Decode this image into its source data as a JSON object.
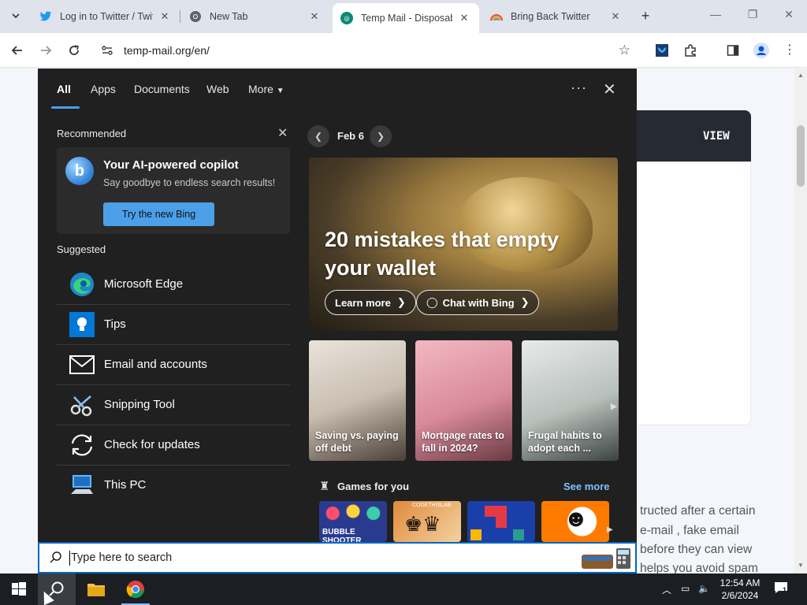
{
  "browser": {
    "tabs": [
      {
        "title": "Log in to Twitter / Twit",
        "icon": "twitter-icon"
      },
      {
        "title": "New Tab",
        "icon": "chrome-icon"
      },
      {
        "title": "Temp Mail - Disposabl",
        "icon": "tempmail-icon",
        "active": true
      },
      {
        "title": "Bring Back Twitter",
        "icon": "rainbow-icon"
      }
    ],
    "url": "temp-mail.org/en/"
  },
  "page": {
    "view_label": "VIEW",
    "text_lines": [
      "tructed after a certain",
      "e-mail , fake email",
      "before they can view",
      "helps you avoid spam"
    ]
  },
  "search_panel": {
    "tabs": [
      "All",
      "Apps",
      "Documents",
      "Web",
      "More"
    ],
    "recommended": {
      "title": "Recommended",
      "card_title": "Your AI-powered copilot",
      "card_subtitle": "Say goodbye to endless search results!",
      "card_button": "Try the new Bing"
    },
    "suggested": {
      "title": "Suggested",
      "items": [
        {
          "label": "Microsoft Edge",
          "icon": "edge-icon"
        },
        {
          "label": "Tips",
          "icon": "tips-icon"
        },
        {
          "label": "Email and accounts",
          "icon": "mail-icon"
        },
        {
          "label": "Snipping Tool",
          "icon": "snipping-tool-icon"
        },
        {
          "label": "Check for updates",
          "icon": "update-icon"
        },
        {
          "label": "This PC",
          "icon": "this-pc-icon"
        }
      ]
    },
    "date": "Feb 6",
    "hero": {
      "title": "20 mistakes that empty your wallet",
      "learn_more": "Learn more",
      "chat_with_bing": "Chat with Bing"
    },
    "news": [
      {
        "caption": "Saving vs. paying off debt"
      },
      {
        "caption": "Mortgage rates to fall in 2024?"
      },
      {
        "caption": "Frugal habits to adopt each ..."
      }
    ],
    "games": {
      "title": "Games for you",
      "see_more": "See more",
      "first_game_label": "BUBBLE SHOOTER",
      "second_game_label": "CODETHISLAB"
    }
  },
  "search_box": {
    "placeholder": "Type here to search"
  },
  "taskbar": {
    "time": "12:54 AM",
    "date": "2/6/2024",
    "notification_count": "1"
  }
}
